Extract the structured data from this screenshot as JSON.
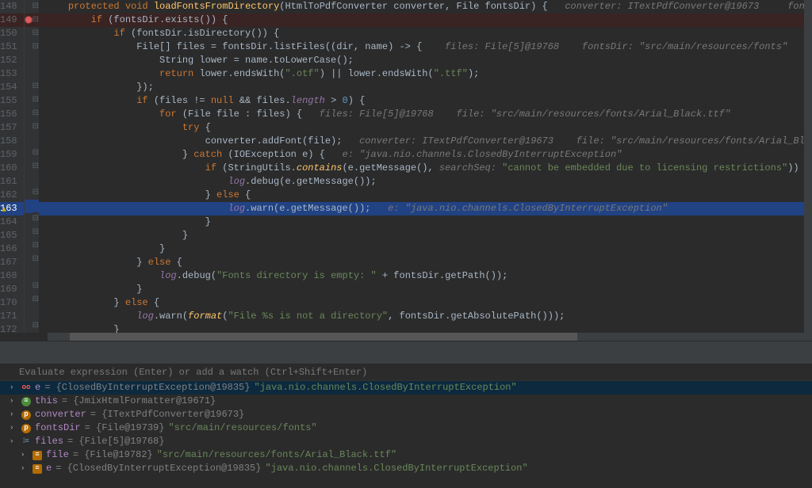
{
  "line_start": 148,
  "highlighted_line": 163,
  "breakpoint_line": 149,
  "code_lines": [
    {
      "n": 148,
      "fold": "⊟",
      "html": "    <span class='kw'>protected void</span> <span class='fn'>loadFontsFromDirectory</span>(HtmlToPdfConverter converter, File fontsDir) {   <span class='hint'>converter: ITextPdfConverter@19673     fontsDir: \"src/main/resources/fonts\"</span>"
    },
    {
      "n": 149,
      "fold": "⊟",
      "html": "        <span class='kw'>if</span> (fontsDir.exists()) {"
    },
    {
      "n": 150,
      "fold": "⊟",
      "html": "            <span class='kw'>if</span> (fontsDir.isDirectory()) {"
    },
    {
      "n": 151,
      "fold": "⊟",
      "html": "                File[] files = fontsDir.listFiles((dir, name) -> {    <span class='hint'>files: File[5]@19768    fontsDir: \"src/main/resources/fonts\"</span>"
    },
    {
      "n": 152,
      "fold": "",
      "html": "                    String lower = name.toLowerCase();"
    },
    {
      "n": 153,
      "fold": "",
      "html": "                    <span class='kw'>return</span> lower.endsWith(<span class='str'>\".otf\"</span>) || lower.endsWith(<span class='str'>\".ttf\"</span>);"
    },
    {
      "n": 154,
      "fold": "⊟",
      "html": "                });"
    },
    {
      "n": 155,
      "fold": "⊟",
      "html": "                <span class='kw'>if</span> (files != <span class='null'>null</span> && files.<span class='field'>length</span> > <span class='num'>0</span>) {"
    },
    {
      "n": 156,
      "fold": "⊟",
      "html": "                    <span class='kw'>for</span> (File file : files) {   <span class='hint'>files: File[5]@19768    file: \"src/main/resources/fonts/Arial_Black.ttf\"</span>"
    },
    {
      "n": 157,
      "fold": "⊟",
      "html": "                        <span class='kw'>try</span> {"
    },
    {
      "n": 158,
      "fold": "",
      "html": "                            converter.addFont(file);   <span class='hint'>converter: ITextPdfConverter@19673    file: \"src/main/resources/fonts/Arial_Black.ttf\"</span>"
    },
    {
      "n": 159,
      "fold": "⊟",
      "html": "                        } <span class='kw'>catch</span> (IOException e) {   <span class='hint'>e: \"java.nio.channels.ClosedByInterruptException\"</span>"
    },
    {
      "n": 160,
      "fold": "⊟",
      "html": "                            <span class='kw'>if</span> (StringUtils.<span class='fn'><i>contains</i></span>(e.getMessage(), <span class='hint'>searchSeq:</span> <span class='str'>\"cannot be embedded due to licensing restrictions\"</span>)) {"
    },
    {
      "n": 161,
      "fold": "",
      "html": "                                <span class='field'>log</span>.debug(e.getMessage());"
    },
    {
      "n": 162,
      "fold": "⊟",
      "html": "                            } <span class='kw'>else</span> {"
    },
    {
      "n": 163,
      "fold": "",
      "html": "                                <span class='field'>log</span>.warn(e.getMessage());   <span class='hint'>e: \"java.nio.channels.ClosedByInterruptException\"</span>"
    },
    {
      "n": 164,
      "fold": "⊟",
      "html": "                            }"
    },
    {
      "n": 165,
      "fold": "⊟",
      "html": "                        }"
    },
    {
      "n": 166,
      "fold": "⊟",
      "html": "                    }"
    },
    {
      "n": 167,
      "fold": "⊟",
      "html": "                } <span class='kw'>else</span> {"
    },
    {
      "n": 168,
      "fold": "",
      "html": "                    <span class='field'>log</span>.debug(<span class='str'>\"Fonts directory is empty: \"</span> + fontsDir.getPath());"
    },
    {
      "n": 169,
      "fold": "⊟",
      "html": "                }"
    },
    {
      "n": 170,
      "fold": "⊟",
      "html": "            } <span class='kw'>else</span> {"
    },
    {
      "n": 171,
      "fold": "",
      "html": "                <span class='field'>log</span>.warn(<span class='fn'><i>format</i></span>(<span class='str'>\"File %s is not a directory\"</span>, fontsDir.getAbsolutePath()));"
    },
    {
      "n": 172,
      "fold": "⊟",
      "html": "            }"
    }
  ],
  "watch_placeholder": "Evaluate expression (Enter) or add a watch (Ctrl+Shift+Enter)",
  "variables": [
    {
      "sel": true,
      "icon": "oo",
      "iconc": "i-exc",
      "name": "e",
      "type": "{ClosedByInterruptException@19835}",
      "val": "\"java.nio.channels.ClosedByInterruptException\"",
      "isStr": true,
      "expand": true
    },
    {
      "sel": false,
      "icon": "≡",
      "iconc": "i-this",
      "name": "this",
      "type": "{JmixHtmlFormatter@19671}",
      "val": "",
      "isStr": false,
      "expand": true
    },
    {
      "sel": false,
      "icon": "p",
      "iconc": "i-p",
      "name": "converter",
      "type": "{ITextPdfConverter@19673}",
      "val": "",
      "isStr": false,
      "expand": true
    },
    {
      "sel": false,
      "icon": "p",
      "iconc": "i-p",
      "name": "fontsDir",
      "type": "{File@19739}",
      "val": "\"src/main/resources/fonts\"",
      "isStr": true,
      "expand": true
    },
    {
      "sel": false,
      "icon": "⦙≡",
      "iconc": "i-f",
      "name": "files",
      "type": "{File[5]@19768}",
      "val": "",
      "isStr": false,
      "expand": true
    },
    {
      "sel": false,
      "icon": "≡",
      "iconc": "i-e",
      "name": "file",
      "type": "{File@19782}",
      "val": "\"src/main/resources/fonts/Arial_Black.ttf\"",
      "isStr": true,
      "expand": true,
      "indent": 1
    },
    {
      "sel": false,
      "icon": "≡",
      "iconc": "i-e",
      "name": "e",
      "type": "{ClosedByInterruptException@19835}",
      "val": "\"java.nio.channels.ClosedByInterruptException\"",
      "isStr": true,
      "expand": true,
      "indent": 1
    }
  ]
}
